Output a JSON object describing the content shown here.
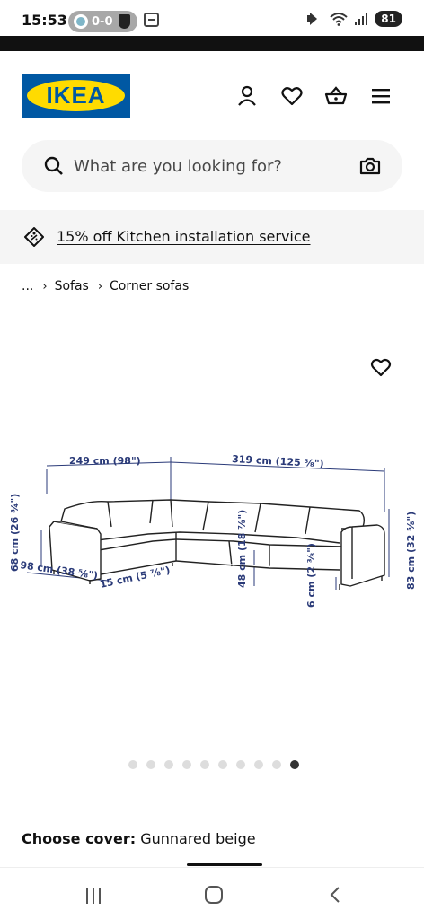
{
  "status_bar": {
    "time": "15:53",
    "score": "0-0",
    "battery": "81"
  },
  "header": {
    "logo_text": "IKEA",
    "icons": [
      "account-icon",
      "wishlist-icon",
      "basket-icon",
      "menu-icon"
    ]
  },
  "search": {
    "placeholder": "What are you looking for?"
  },
  "promo": {
    "text": "15% off Kitchen installation service"
  },
  "breadcrumb": {
    "ellipsis": "...",
    "items": [
      "Sofas",
      "Corner sofas"
    ]
  },
  "diagram": {
    "width_left": "249 cm (98\")",
    "width_right": "319 cm (125 ⅝\")",
    "armrest_height": "68 cm (26 ¾\")",
    "depth": "98 cm (38 ⅝\")",
    "arm_width": "15 cm (5 ⅞\")",
    "seat_height": "48 cm (18 ⅞\")",
    "leg_height": "6 cm (2 ⅜\")",
    "total_height": "83 cm (32 ⅝\")"
  },
  "carousel": {
    "total": 10,
    "active_index": 9
  },
  "cover": {
    "label": "Choose cover:",
    "value": "Gunnared beige"
  },
  "colors": {
    "ikea_blue": "#0058a3",
    "ikea_yellow": "#ffdb00",
    "dimension_text": "#2a3a78"
  }
}
